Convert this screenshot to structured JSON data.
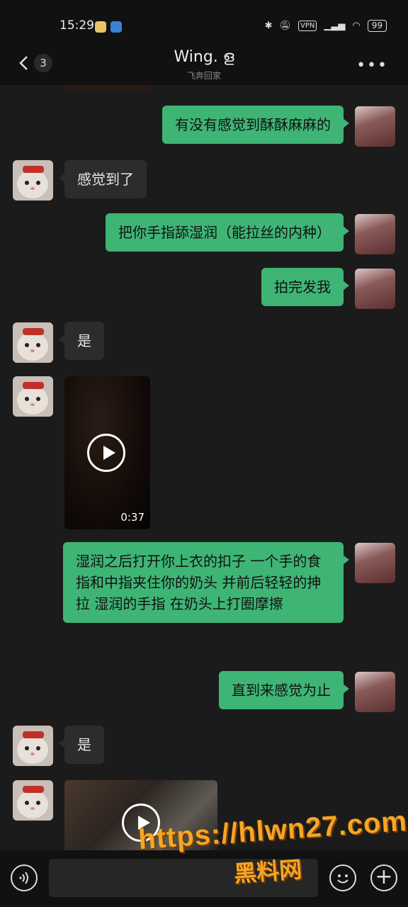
{
  "status_bar": {
    "time": "15:29",
    "vpn": "VPN",
    "battery": "99"
  },
  "header": {
    "unread_count": "3",
    "title": "Wing. ള",
    "subtitle": "飞奔回家",
    "more": "•••"
  },
  "messages": [
    {
      "from": "me",
      "text": "有没有感觉到酥酥麻麻的"
    },
    {
      "from": "them",
      "text": "感觉到了"
    },
    {
      "from": "me",
      "text": "把你手指舔湿润（能拉丝的内种）"
    },
    {
      "from": "me",
      "text": "拍完发我"
    },
    {
      "from": "them",
      "text": "是"
    },
    {
      "from": "them",
      "type": "video",
      "duration": "0:37"
    },
    {
      "from": "me",
      "text": "湿润之后打开你上衣的扣子 一个手的食指和中指夹住你的奶头 并前后轻轻的抻拉 湿润的手指 在奶头上打圈摩擦"
    },
    {
      "from": "me",
      "text": "直到来感觉为止"
    },
    {
      "from": "them",
      "text": "是"
    },
    {
      "from": "them",
      "type": "video"
    }
  ],
  "watermark": {
    "line1": "https://hlwn27.com",
    "line2": "黑料网"
  },
  "colors": {
    "outgoing_bubble": "#3eb575",
    "incoming_bubble": "#2c2c2c",
    "background": "#1b1b1b"
  }
}
